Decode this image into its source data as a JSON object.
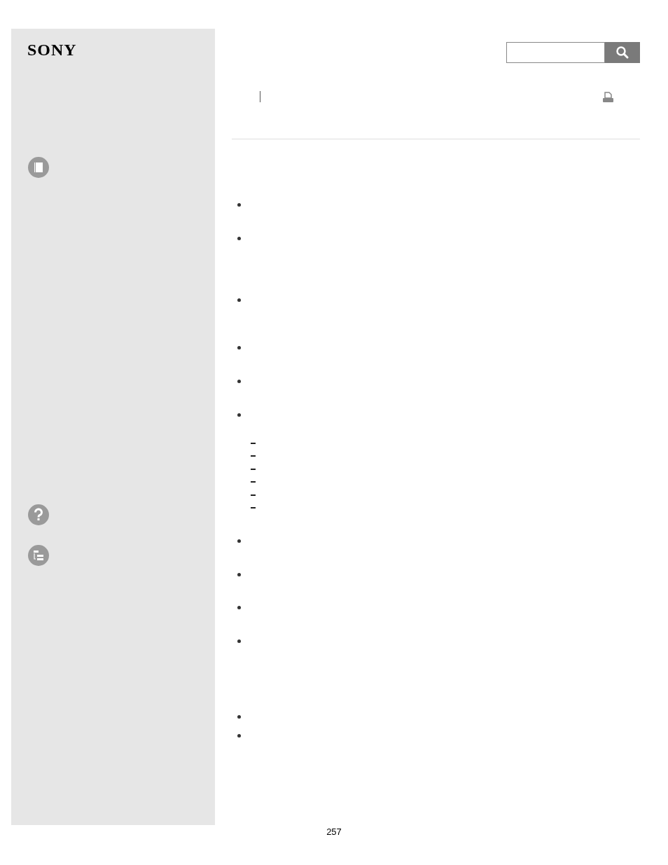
{
  "sidebar": {
    "logo": "SONY"
  },
  "footer": {
    "page_number": "257"
  }
}
